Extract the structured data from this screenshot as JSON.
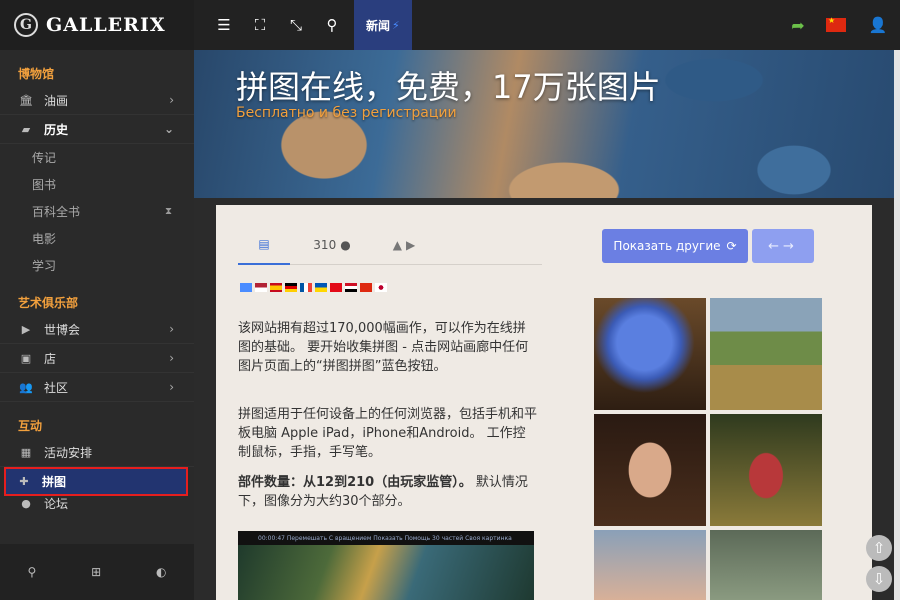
{
  "brand": {
    "name": "GALLERIX",
    "badge": "G"
  },
  "sidebar": {
    "sections": [
      {
        "title": "博物馆"
      },
      {
        "title": "艺术俱乐部"
      },
      {
        "title": "互动"
      }
    ],
    "museum_items": [
      {
        "label": "油画",
        "icon": "bank-icon"
      },
      {
        "label": "历史",
        "icon": "book-icon"
      }
    ],
    "history_sub": [
      "传记",
      "图书",
      "百科全书",
      "电影",
      "学习"
    ],
    "club_items": [
      {
        "label": "世博会",
        "icon": "play-icon"
      },
      {
        "label": "店",
        "icon": "shop-icon"
      },
      {
        "label": "社区",
        "icon": "users-icon"
      }
    ],
    "interactive_items": [
      {
        "label": "活动安排",
        "icon": "calendar-icon"
      },
      {
        "label": "拼图",
        "icon": "puzzle-icon"
      },
      {
        "label": "论坛",
        "icon": "forum-icon"
      }
    ]
  },
  "topbar": {
    "news_label": "新闻"
  },
  "hero": {
    "title": "拼图在线，免费，17万张图片",
    "subtitle": "Бесплатно и без регистрации"
  },
  "content": {
    "tabs": [
      {
        "label": "",
        "icon": "document-icon"
      },
      {
        "label": "310",
        "icon": "comment-icon"
      },
      {
        "label": "",
        "icon": "android-icon"
      }
    ],
    "show_button": "Показать другие",
    "para1": "该网站拥有超过170,000幅画作，可以作为在线拼图的基础。 要开始收集拼图 - 点击网站画廊中任何图片页面上的“拼图拼图”蓝色按钮。",
    "para2": "拼图适用于任何设备上的任何浏览器，包括手机和平板电脑 Apple iPad，iPhone和Android。 工作控制鼠标，手指，手写笔。",
    "para3_strong": "部件数量：从12到210（由玩家监管）。",
    "para3_rest": " 默认情况下，图像分为大约30个部分。",
    "preview_bar": "00:00:47   Перемешать   С вращением   Показать   Помощь   30 частей   Своя картинка"
  },
  "colors": {
    "accent": "#f2a03d",
    "active_bg": "#223470",
    "highlight_border": "#e51e1e",
    "button": "#6b7fe3"
  }
}
